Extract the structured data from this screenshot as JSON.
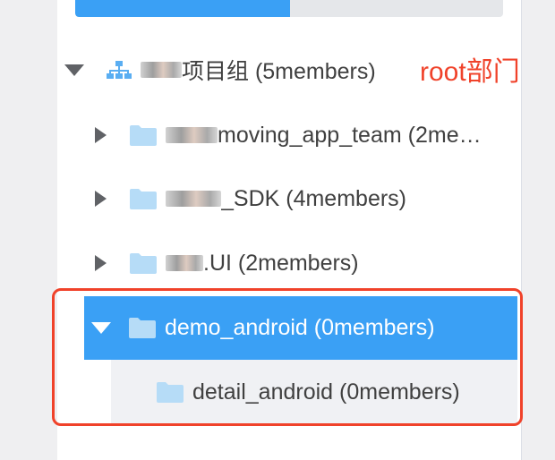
{
  "annotation": {
    "text": "root部门",
    "color": "#f0422a"
  },
  "colors": {
    "accent": "#3aa0f5",
    "folder": "#b6dcf7",
    "highlight_outline": "#f0422a"
  },
  "tree": {
    "root": {
      "label": "项目组 (5members)",
      "icon": "org-chart-icon",
      "expanded": true
    },
    "children": [
      {
        "label": "moving_app_team (2me…",
        "icon": "folder-icon",
        "expanded": false
      },
      {
        "label": "_SDK (4members)",
        "icon": "folder-icon",
        "expanded": false
      },
      {
        "label": ".UI (2members)",
        "icon": "folder-icon",
        "expanded": false
      },
      {
        "label": "demo_android (0members)",
        "icon": "folder-icon",
        "expanded": true,
        "selected": true
      }
    ],
    "grandchild": {
      "label": "detail_android (0members)",
      "icon": "folder-icon"
    }
  }
}
